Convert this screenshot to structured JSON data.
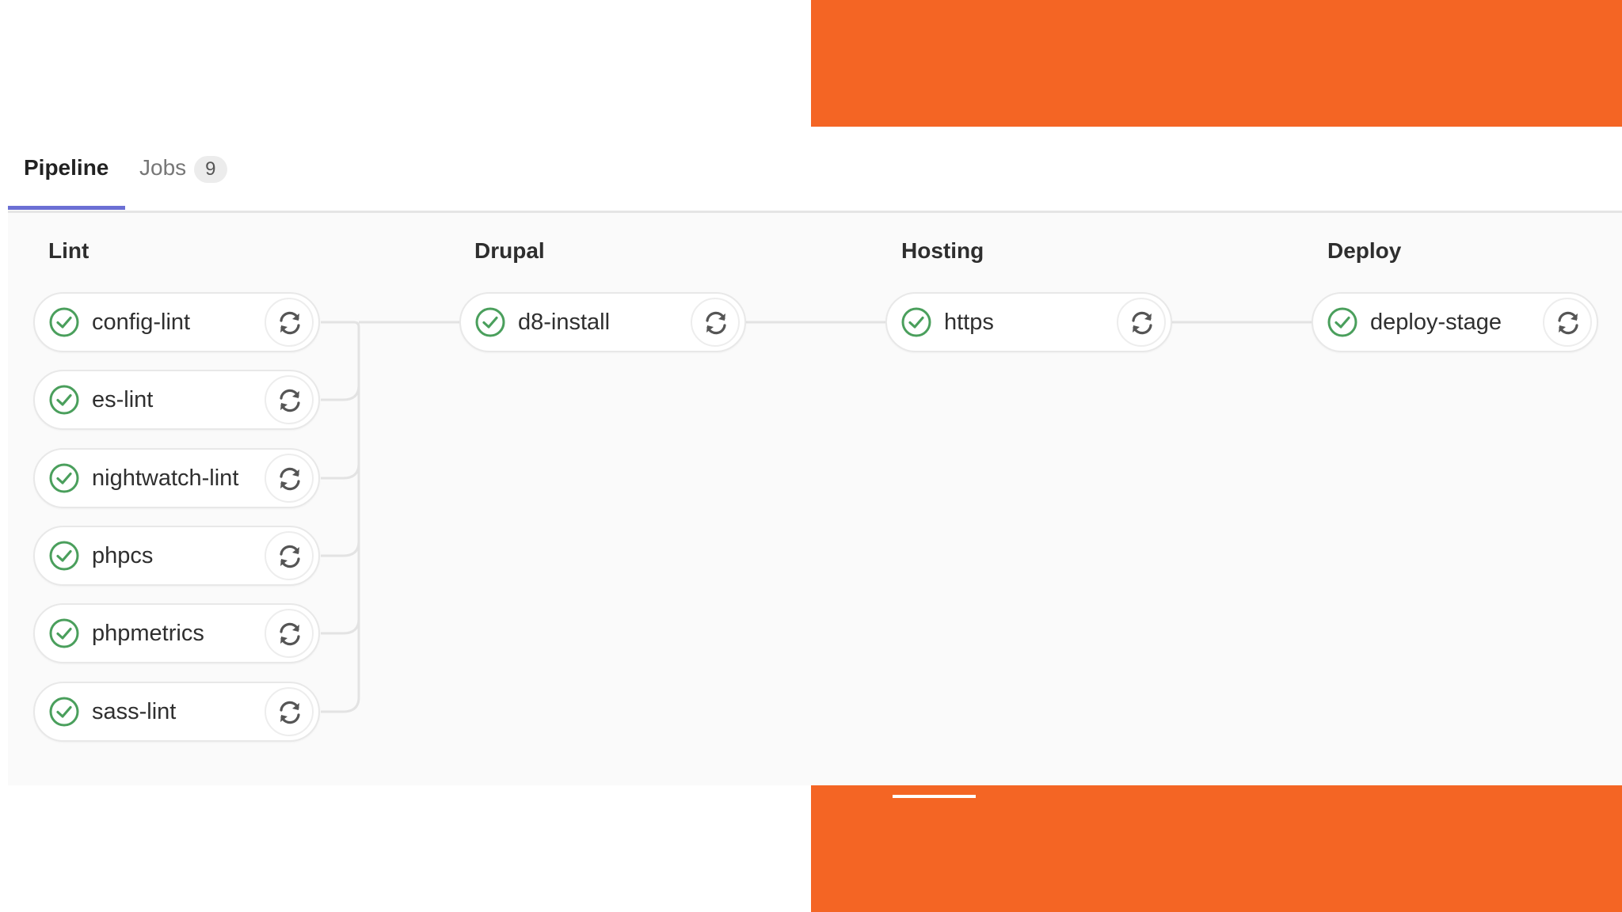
{
  "tabs": {
    "pipeline_label": "Pipeline",
    "jobs_label": "Jobs",
    "jobs_count": "9"
  },
  "stages": [
    {
      "title": "Lint",
      "jobs": [
        "config-lint",
        "es-lint",
        "nightwatch-lint",
        "phpcs",
        "phpmetrics",
        "sass-lint"
      ]
    },
    {
      "title": "Drupal",
      "jobs": [
        "d8-install"
      ]
    },
    {
      "title": "Hosting",
      "jobs": [
        "https"
      ]
    },
    {
      "title": "Deploy",
      "jobs": [
        "deploy-stage"
      ]
    }
  ],
  "icons": {
    "status": "check-circle-icon",
    "retry": "retry-icon"
  },
  "colors": {
    "success": "#4a9f5c",
    "accent_orange": "#f46524",
    "tab_active": "#6b6fd4"
  }
}
